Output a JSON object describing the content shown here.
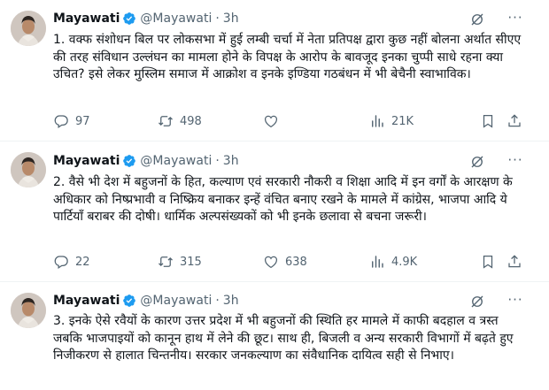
{
  "tweets": [
    {
      "name": "Mayawati",
      "handle": "@Mayawati",
      "dot": "·",
      "time": "3h",
      "text": "1. वक्फ संशोधन बिल पर लोकसभा में हुई लम्बी चर्चा में नेता प्रतिपक्ष द्वारा कुछ नहीं बोलना अर्थात सीएए की तरह संविधान उल्लंघन का मामला होने के विपक्ष के आरोप के बावजूद इनका चुप्पी साधे रहना क्या उचित? इसे लेकर मुस्लिम समाज में आक्रोश व इनके इण्डिया गठबंधन में भी बेचैनी स्वाभाविक।",
      "replies": "97",
      "reposts": "498",
      "likes": "",
      "views": "21K"
    },
    {
      "name": "Mayawati",
      "handle": "@Mayawati",
      "dot": "·",
      "time": "3h",
      "text": "2. वैसे भी देश में बहुजनों के हित, कल्याण एवं सरकारी नौकरी व शिक्षा आदि में इन वर्गों के आरक्षण के अधिकार को निष्प्रभावी व निष्क्रिय बनाकर इन्हें वंचित बनाए रखने के मामले में कांग्रेस, भाजपा आदि ये पार्टियाँ बराबर की दोषी। धार्मिक अल्पसंख्यकों को भी इनके छलावा से बचना जरूरी।",
      "replies": "22",
      "reposts": "315",
      "likes": "638",
      "views": "4.9K"
    },
    {
      "name": "Mayawati",
      "handle": "@Mayawati",
      "dot": "·",
      "time": "3h",
      "text": "3. इनके ऐसे रवैयों के कारण उत्तर प्रदेश में भी बहुजनों की स्थिति हर मामले में काफी बदहाल व त्रस्त जबकि भाजपाइयों को कानून हाथ में लेने की छूट। साथ ही, बिजली व अन्य सरकारी विभागों में बढ़ते हुए निजीकरण से हालात चिन्तनीय। सरकार जनकल्याण का संवैधानिक दायित्व सही से निभाए।"
    }
  ],
  "colors": {
    "verified": "#1d9bf0",
    "muted": "#536471",
    "text": "#0f1419",
    "divider": "#eff3f4"
  },
  "icons": [
    "verified-badge-icon",
    "grok-icon",
    "more-icon",
    "reply-icon",
    "repost-icon",
    "like-icon",
    "views-icon",
    "bookmark-icon",
    "share-icon"
  ]
}
